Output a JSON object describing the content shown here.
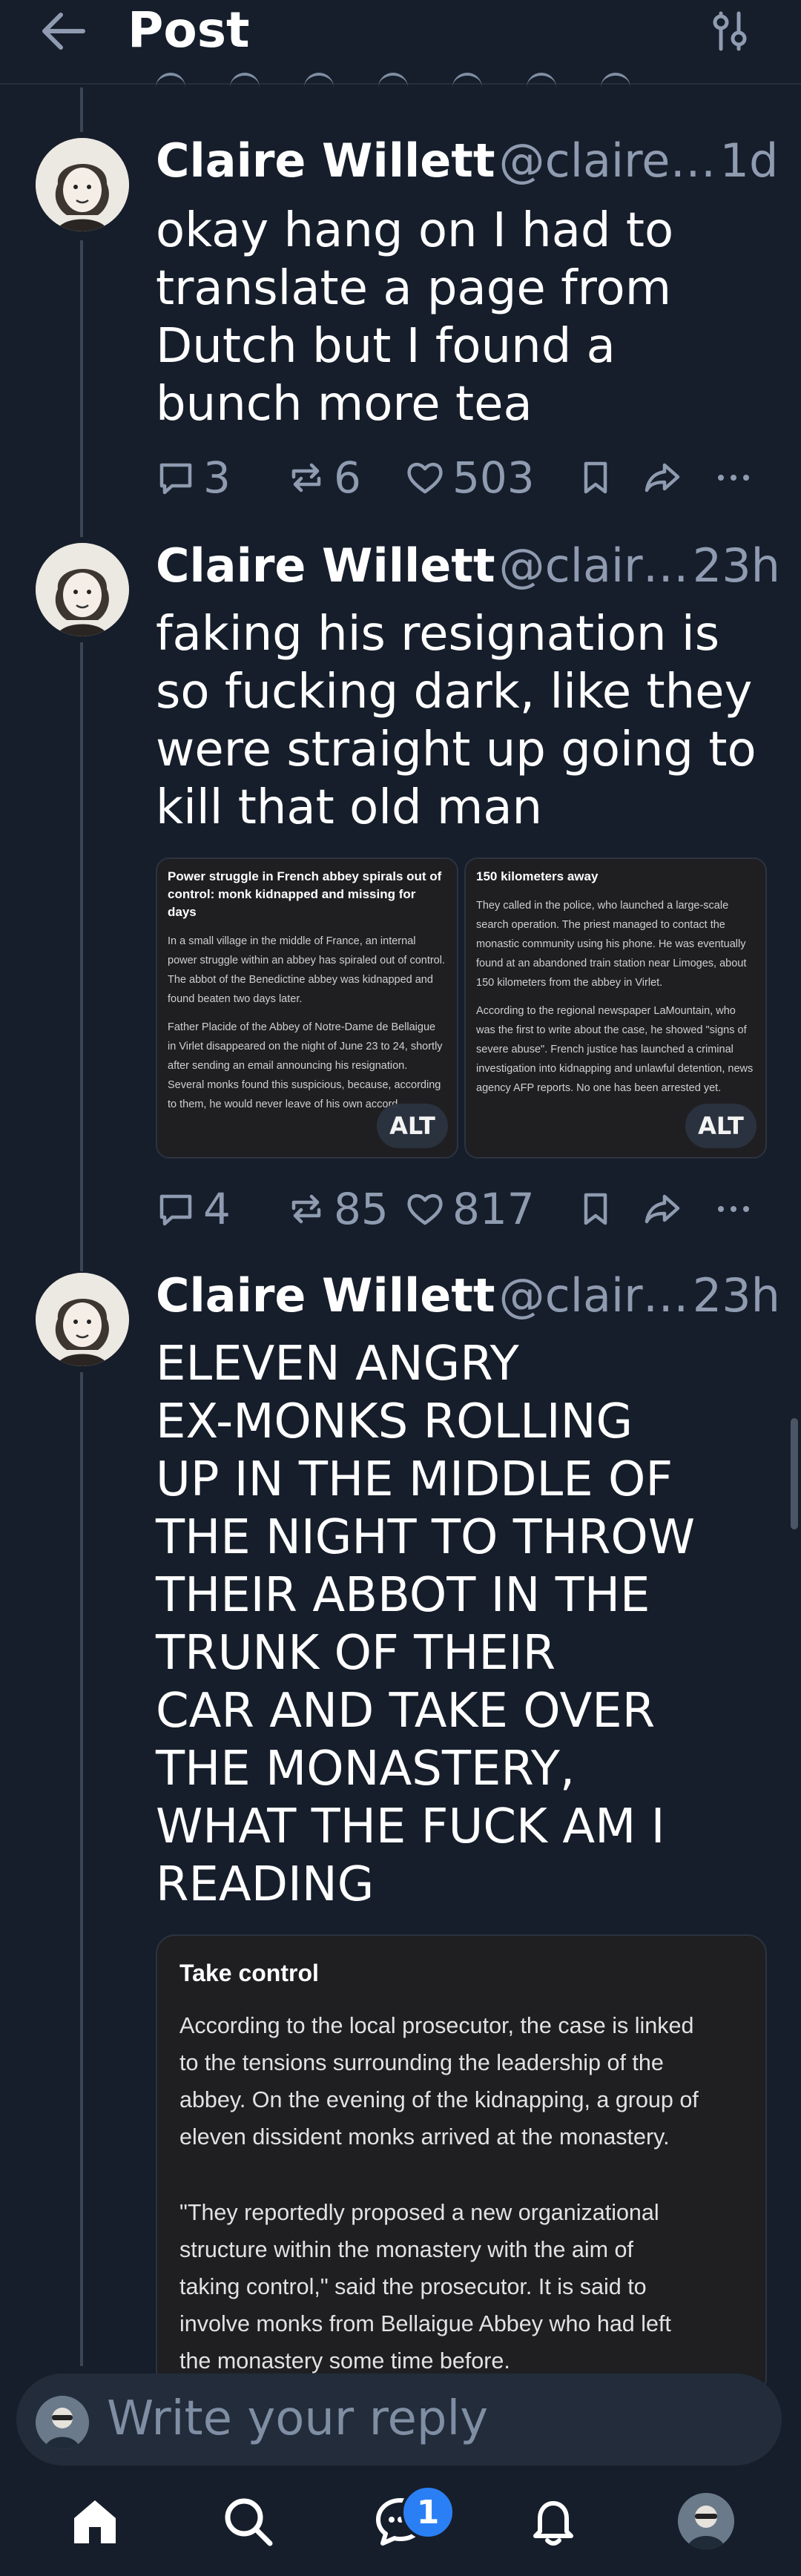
{
  "header": {
    "title": "Post"
  },
  "posts": [
    {
      "name": "Claire Willett",
      "handle": "@claire…",
      "time": "1d",
      "lines": [
        "okay hang on I had to",
        "translate a page from",
        "Dutch but I found a",
        "bunch more tea"
      ],
      "replies": "3",
      "reposts": "6",
      "likes": "503"
    },
    {
      "name": "Claire Willett",
      "handle": "@clair…",
      "time": "23h",
      "lines": [
        "faking his resignation is",
        "so fucking dark, like they",
        "were straight up going to",
        "kill that old man"
      ],
      "replies": "4",
      "reposts": "85",
      "likes": "817",
      "images": [
        {
          "title": "Power struggle in French abbey spirals out of control: monk kidnapped and missing for days",
          "paragraphs": [
            "In a small village in the middle of France, an internal power struggle within an abbey has spiraled out of control. The abbot of the Benedictine abbey was kidnapped and found beaten two days later.",
            "Father Placide of the Abbey of Notre-Dame de Bellaigue in Virlet disappeared on the night of June 23 to 24, shortly after sending an email announcing his resignation. Several monks found this suspicious, because, according to them, he would never leave of his own accord."
          ],
          "alt": "ALT"
        },
        {
          "title": "150 kilometers away",
          "paragraphs": [
            "They called in the police, who launched a large-scale search operation. The priest managed to contact the monastic community using his phone. He was eventually found at an abandoned train station near Limoges, about 150 kilometers from the abbey in Virlet.",
            "According to the regional newspaper LaMountain, who was the first to write about the case, he showed \"signs of severe abuse\". French justice has launched a criminal investigation into kidnapping and unlawful detention, news agency AFP reports. No one has been arrested yet."
          ],
          "alt": "ALT"
        }
      ]
    },
    {
      "name": "Claire Willett",
      "handle": "@clair…",
      "time": "23h",
      "lines": [
        "ELEVEN ANGRY",
        "EX-MONKS ROLLING",
        "UP IN THE MIDDLE OF",
        "THE NIGHT TO THROW",
        "THEIR ABBOT IN THE",
        "TRUNK OF THEIR",
        "CAR AND TAKE OVER",
        "THE MONASTERY,",
        "WHAT THE FUCK AM I",
        "READING"
      ],
      "quote": {
        "title": "Take control",
        "p1": [
          "According to the local prosecutor, the case is linked",
          "to the tensions surrounding the leadership of the",
          "abbey. On the evening of the kidnapping, a group of",
          "eleven dissident monks arrived at the monastery."
        ],
        "p2": [
          "\"They reportedly proposed a new organizational",
          "structure within the monastery with the aim of",
          "taking control,\" said the prosecutor. It is said to",
          "involve monks from Bellaigue Abbey who had left",
          "the monastery some time before."
        ]
      }
    }
  ],
  "reply": {
    "placeholder": "Write your reply"
  },
  "nav": {
    "notification_badge": "1"
  },
  "colors": {
    "background": "#161e2b",
    "muted": "#8f9bb0",
    "accent": "#2a7ff5"
  }
}
